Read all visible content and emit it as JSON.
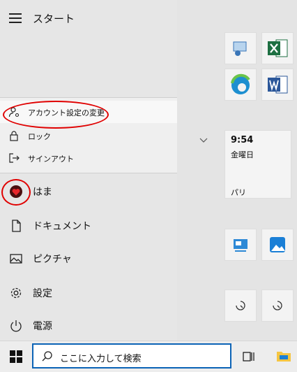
{
  "start": {
    "title": "スタート"
  },
  "account_menu": {
    "change_settings": "アカウント設定の変更",
    "lock": "ロック",
    "sign_out": "サインアウト"
  },
  "nav": [
    {
      "label": "はま",
      "icon": "user-heart-icon"
    },
    {
      "label": "ドキュメント",
      "icon": "document-icon"
    },
    {
      "label": "ピクチャ",
      "icon": "picture-icon"
    },
    {
      "label": "設定",
      "icon": "gear-icon"
    },
    {
      "label": "電源",
      "icon": "power-icon"
    }
  ],
  "calendar_tile": {
    "time": "9:54",
    "day": "金曜日",
    "city": "パリ"
  },
  "taskbar": {
    "search_placeholder": "ここに入力して検索"
  },
  "colors": {
    "accent": "#0b63b6",
    "highlight_red": "#e00000",
    "excel": "#1d6f42",
    "word": "#2b579a"
  }
}
